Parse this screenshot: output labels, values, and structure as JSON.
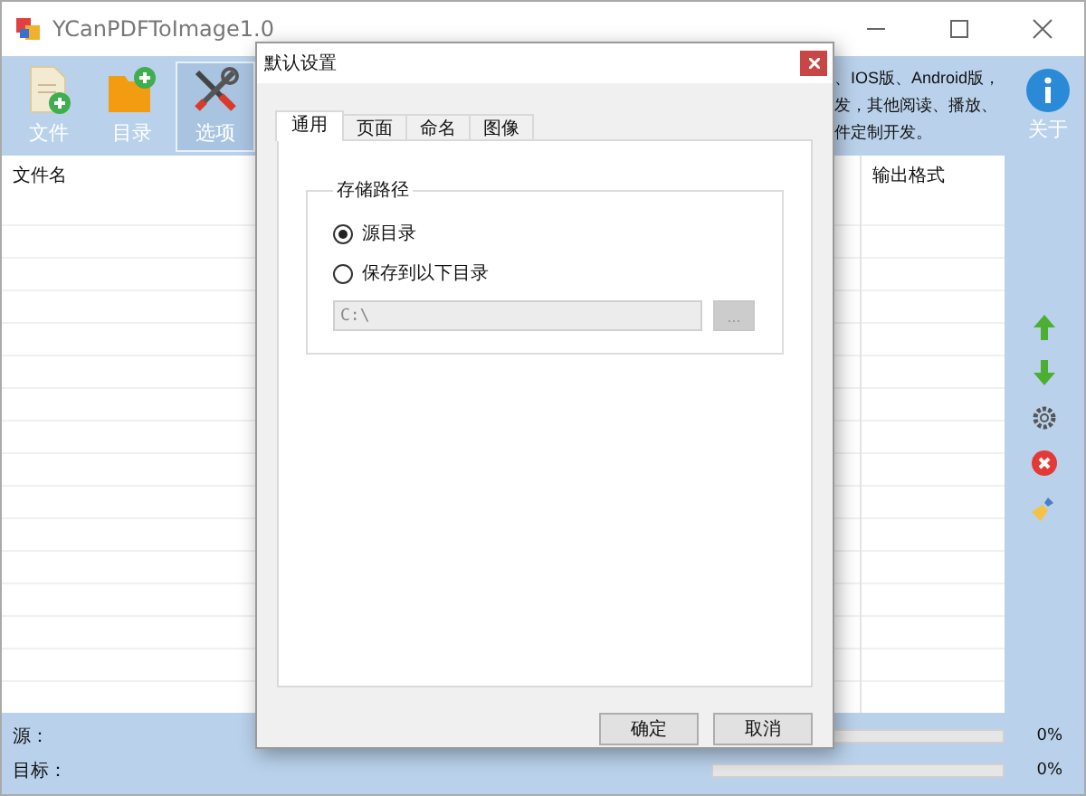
{
  "window": {
    "title": "YCanPDFToImage1.0"
  },
  "toolbar": {
    "buttons": [
      {
        "label": "文件",
        "kind": "file",
        "selected": false
      },
      {
        "label": "目录",
        "kind": "folder",
        "selected": false
      },
      {
        "label": "选项",
        "kind": "tools",
        "selected": true
      }
    ],
    "description": [
      "、IOS版、Android版，",
      "发，其他阅读、播放、",
      "件定制开发。"
    ],
    "about": {
      "label": "关于"
    }
  },
  "table": {
    "columns": [
      "文件名",
      "输出格式"
    ]
  },
  "side_buttons": [
    {
      "kind": "up"
    },
    {
      "kind": "down"
    },
    {
      "kind": "gear"
    },
    {
      "kind": "delete"
    },
    {
      "kind": "clear"
    }
  ],
  "status": [
    {
      "label": "源：",
      "level": 0,
      "reading": "0%"
    },
    {
      "label": "目标：",
      "level": 0,
      "reading": "0%"
    }
  ],
  "dialog": {
    "title": "默认设置",
    "tabs": [
      {
        "label": "通用",
        "selected": true
      },
      {
        "label": "页面",
        "selected": false
      },
      {
        "label": "命名",
        "selected": false
      },
      {
        "label": "图像",
        "selected": false
      }
    ],
    "group": {
      "title": "存储路径",
      "options": [
        {
          "label": "源目录",
          "selected": true
        },
        {
          "label": "保存到以下目录",
          "selected": false
        }
      ],
      "path": {
        "value": "C:\\",
        "disabled": true
      },
      "browse": {
        "label": "...",
        "disabled": true
      }
    },
    "buttons": [
      "确定",
      "取消"
    ]
  }
}
